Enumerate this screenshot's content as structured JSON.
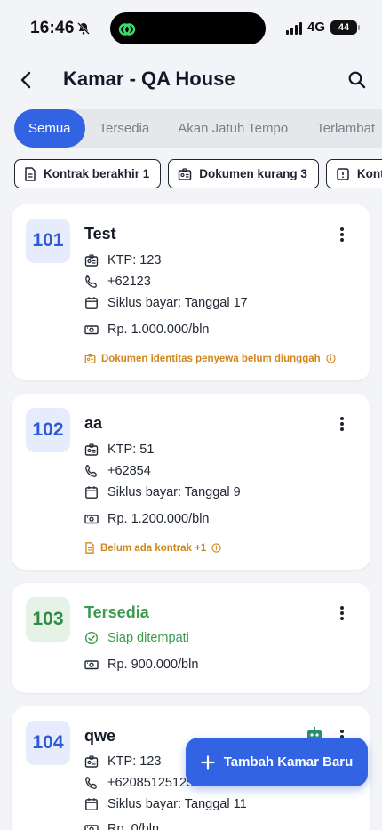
{
  "status_bar": {
    "time": "16:46",
    "network": "4G",
    "battery": "44"
  },
  "header": {
    "title": "Kamar - QA House"
  },
  "tabs": [
    {
      "label": "Semua",
      "active": true
    },
    {
      "label": "Tersedia",
      "active": false
    },
    {
      "label": "Akan Jatuh Tempo",
      "active": false
    },
    {
      "label": "Terlambat",
      "active": false
    }
  ],
  "filters": [
    {
      "label": "Kontrak berakhir 1",
      "icon": "document-icon"
    },
    {
      "label": "Dokumen kurang 3",
      "icon": "id-card-icon"
    },
    {
      "label": "Kontrak",
      "icon": "alert-icon"
    }
  ],
  "rooms": [
    {
      "number": "101",
      "name": "Test",
      "ktp": "KTP: 123",
      "phone": "+62123",
      "cycle": "Siklus bayar: Tanggal 17",
      "price": "Rp. 1.000.000/bln",
      "warning": "Dokumen identitas penyewa belum diunggah"
    },
    {
      "number": "102",
      "name": "aa",
      "ktp": "KTP: 51",
      "phone": "+62854",
      "cycle": "Siklus bayar: Tanggal 9",
      "price": "Rp. 1.200.000/bln",
      "warning": "Belum ada kontrak +1"
    },
    {
      "number": "103",
      "name": "Tersedia",
      "status": "Siap ditempati",
      "price": "Rp. 900.000/bln"
    },
    {
      "number": "104",
      "name": "qwe",
      "ktp": "KTP: 123",
      "phone": "+62085125125",
      "cycle": "Siklus bayar: Tanggal 11",
      "price": "Rp. 0/bln"
    }
  ],
  "fab": {
    "label": "Tambah Kamar Baru"
  },
  "colors": {
    "primary": "#3163e3",
    "warning": "#d2861a",
    "available": "#3a9a4e",
    "room_badge_bg": "#e6ecfb"
  }
}
